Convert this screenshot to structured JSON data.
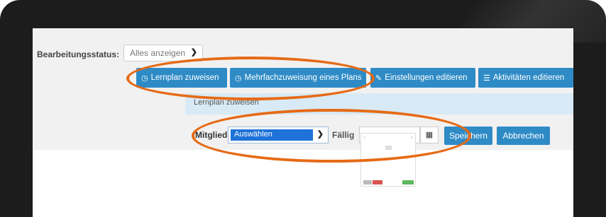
{
  "status_filter": {
    "label": "Bearbeitungsstatus:",
    "value": "Alles anzeigen"
  },
  "actions": [
    {
      "label": "Lernplan zuweisen",
      "icon": "clock-icon"
    },
    {
      "label": "Mehrfachzuweisung eines Plans",
      "icon": "clock-icon"
    },
    {
      "label": "Einstellungen editieren",
      "icon": "pencil-icon"
    },
    {
      "label": "Aktivitäten editieren",
      "icon": "list-icon"
    }
  ],
  "assign_panel": {
    "title": "Lernplan zuweisen",
    "member_label": "Mitglied",
    "member_value": "Auswählen",
    "due_label": "Fällig",
    "save_label": "Speichern",
    "cancel_label": "Abbrechen"
  },
  "colors": {
    "primary": "#2e8bc6",
    "highlight": "#e66a16",
    "panel_head": "#d8eaf5"
  }
}
